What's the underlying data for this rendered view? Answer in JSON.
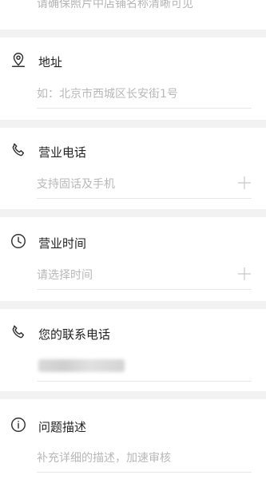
{
  "top_hint": "请确保照片中店铺名称清晰可见",
  "sections": [
    {
      "icon": "location-pin-icon",
      "label": "地址",
      "placeholder": "如：北京市西城区长安街1号",
      "has_plus": false
    },
    {
      "icon": "phone-icon",
      "label": "营业电话",
      "placeholder": "支持固话及手机",
      "has_plus": true
    },
    {
      "icon": "clock-icon",
      "label": "营业时间",
      "placeholder": "请选择时间",
      "has_plus": true
    },
    {
      "icon": "phone-icon",
      "label": "您的联系电话",
      "placeholder": "",
      "has_plus": false
    },
    {
      "icon": "info-icon",
      "label": "问题描述",
      "placeholder": "补充详细的描述，加速审核",
      "has_plus": false
    }
  ]
}
